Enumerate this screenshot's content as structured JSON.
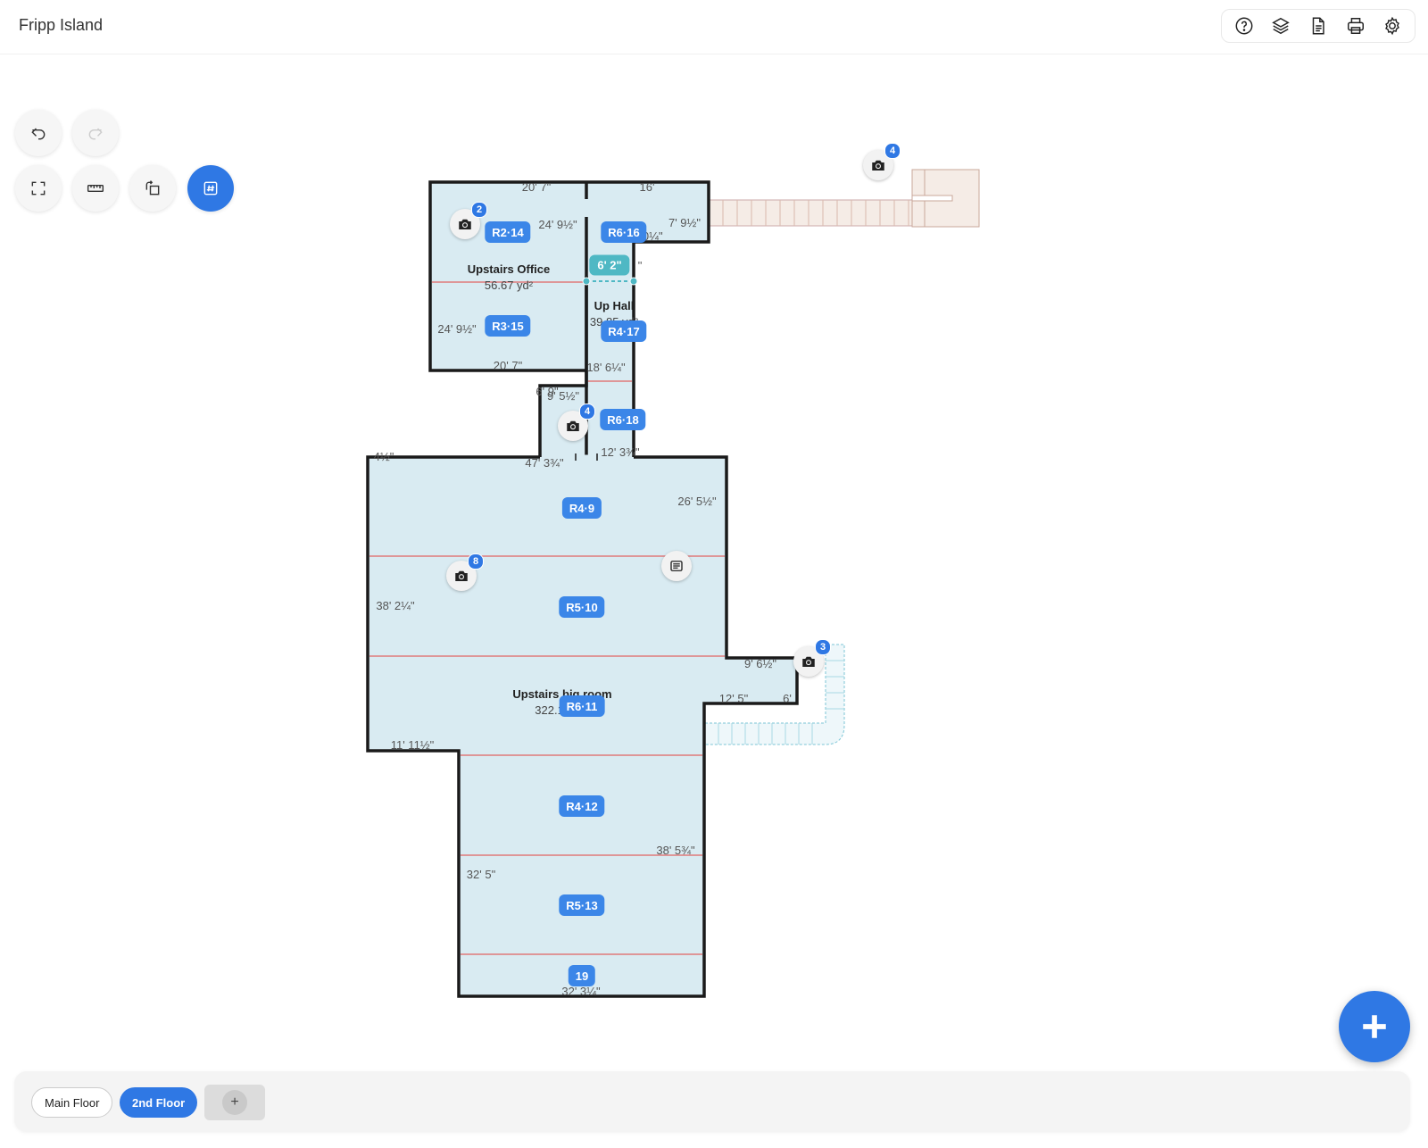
{
  "app": {
    "title": "Fripp Island"
  },
  "top_tools": [
    {
      "name": "help-icon"
    },
    {
      "name": "layers-icon"
    },
    {
      "name": "document-icon"
    },
    {
      "name": "printer-icon"
    },
    {
      "name": "settings-icon"
    }
  ],
  "left_tools": {
    "undo": "undo-icon",
    "redo": "redo-icon",
    "fit": "fit-screen-icon",
    "ruler": "ruler-icon",
    "rotate": "rotate-icon",
    "grid": "grid-number-icon"
  },
  "rooms": {
    "office": {
      "name": "Upstairs Office",
      "area": "56.67 yd²"
    },
    "hall": {
      "name": "Up Hall",
      "area": "39.85 yd²"
    },
    "big": {
      "name": "Upstairs big room",
      "area": "322.19 yd²"
    }
  },
  "badges": [
    "R2·14",
    "R6·16",
    "R3·15",
    "R4·17",
    "R6·18",
    "R4·9",
    "R5·10",
    "R6·11",
    "R4·12",
    "R5·13",
    "19"
  ],
  "measure_chip": "6' 2\"",
  "dimensions": {
    "d1": "20' 7\"",
    "d2": "16'",
    "d3": "24' 9½\"",
    "d4": "7' 9½\"",
    "d5": "9' 10¼\"",
    "d6": "24' 9½\"",
    "d7": "20' 7\"",
    "d8": "18' 6¼\"",
    "d9": "9' 5½\"",
    "d10": "6' 9\"",
    "d11": "12' 3¾\"",
    "d12": "47' 3¾\"",
    "d13": "4½\"",
    "d14": "26' 5½\"",
    "d15": "38' 2¼\"",
    "d16": "9' 6½\"",
    "d17": "12' 5\"",
    "d18": "6'",
    "d19": "11' 11½\"",
    "d20": "38' 5¾\"",
    "d21": "32' 5\"",
    "d22": "32' 3¼\"",
    "d23": "\""
  },
  "cameras": [
    {
      "count": "2"
    },
    {
      "count": "4"
    },
    {
      "count": "8"
    },
    {
      "count": "3"
    },
    {
      "count": "4"
    }
  ],
  "floors": {
    "main": "Main Floor",
    "second": "2nd Floor",
    "add": "+"
  },
  "colors": {
    "accent": "#2f78e4",
    "room_fill": "#d9ebf2",
    "wall": "#1a1a1a",
    "seam": "#e07a7a"
  }
}
